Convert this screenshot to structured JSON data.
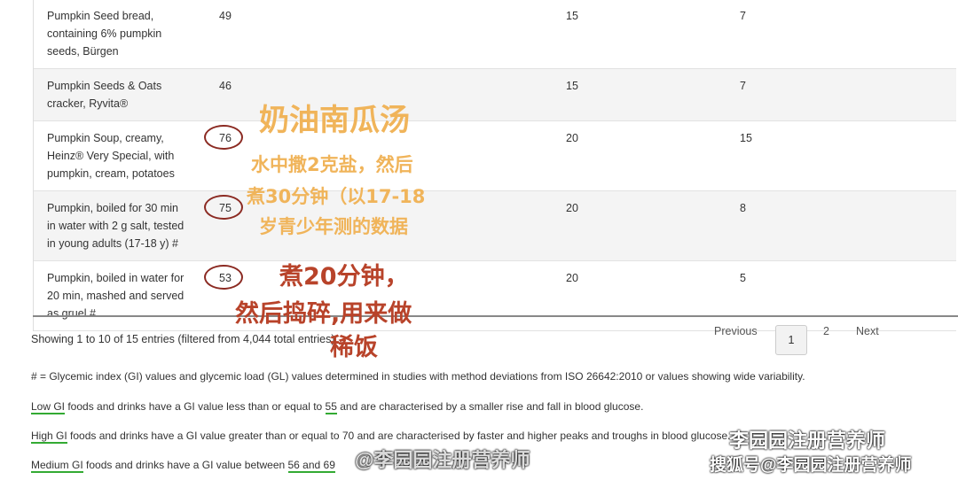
{
  "rows": [
    {
      "name": "Pumpkin Seed bread, containing 6% pumpkin seeds, Bürgen",
      "gi": "49",
      "c2": "15",
      "c3": "7",
      "circled": false,
      "alt": false
    },
    {
      "name": "Pumpkin Seeds & Oats cracker, Ryvita®",
      "gi": "46",
      "c2": "15",
      "c3": "7",
      "circled": false,
      "alt": true
    },
    {
      "name": "Pumpkin Soup, creamy, Heinz® Very Special, with pumpkin, cream, potatoes",
      "gi": "76",
      "c2": "20",
      "c3": "15",
      "circled": true,
      "alt": false
    },
    {
      "name": "Pumpkin, boiled for 30 min in water with 2 g salt, tested in young adults (17-18 y) #",
      "gi": "75",
      "c2": "20",
      "c3": "8",
      "circled": true,
      "alt": true
    },
    {
      "name": "Pumpkin, boiled in water for 20 min, mashed and served as gruel #",
      "gi": "53",
      "c2": "20",
      "c3": "5",
      "circled": true,
      "alt": false
    }
  ],
  "info": "Showing 1 to 10 of 15 entries (filtered from 4,044 total entries)",
  "pager": {
    "previous": "Previous",
    "page1": "1",
    "page2": "2",
    "next": "Next"
  },
  "notes": {
    "hash": "# = Glycemic index (GI) values and glycemic load (GL) values determined in studies with method deviations from ISO 26642:2010 or values showing wide variability.",
    "low_a": "Low GI",
    "low_b": " foods and drinks have a GI value less than or equal to ",
    "low_c": "55",
    "low_d": " and are characterised by a smaller rise and fall in blood glucose.",
    "high_a": "High GI",
    "high_b": " foods and drinks have a GI value greater than or equal to 70 and are characterised by faster and higher peaks and troughs in blood glucose.",
    "med_a": "Medium GI",
    "med_b": " foods and drinks have a GI value between ",
    "med_c": "56 and 69"
  },
  "overlay": {
    "title": "奶油南瓜汤",
    "line1": "水中撒2克盐，然后",
    "line2": "煮30分钟（以17-18",
    "line3": "岁青少年测的数据",
    "red1": "煮20分钟，",
    "red2": "然后捣碎,用来做",
    "red3": "稀饭",
    "yellow": "#f0b45a",
    "red": "#b8432a"
  },
  "watermarks": {
    "weibo": "@李园园注册营养师",
    "wechat": "李园园注册营养师",
    "sohu": "搜狐号@李园园注册营养师"
  }
}
